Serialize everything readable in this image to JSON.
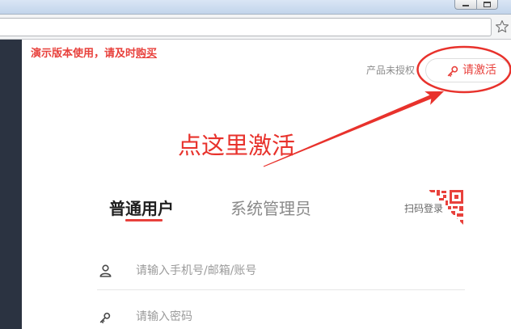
{
  "browser": {
    "icons": {
      "minimize": "minimize-icon",
      "maximize": "maximize-icon",
      "bookmark": "star-icon"
    }
  },
  "notice": {
    "prefix": "演示版本使用，请及时",
    "link": "购买"
  },
  "license": {
    "status": "产品未授权",
    "activate_label": "请激活",
    "activate_icon": "key-icon"
  },
  "annotation": {
    "text": "点这里激活"
  },
  "login": {
    "tabs": [
      {
        "label": "普通用户",
        "active": true
      },
      {
        "label": "系统管理员",
        "active": false
      }
    ],
    "qr_login": {
      "label": "扫码登录",
      "icon": "qr-code-icon"
    },
    "fields": [
      {
        "icon": "user-icon",
        "placeholder": "请输入手机号/邮箱/账号"
      },
      {
        "icon": "key-icon",
        "placeholder": "请输入密码"
      }
    ]
  },
  "colors": {
    "accent": "#e8413c",
    "annotation": "#e8322c",
    "sidebar": "#2b3341",
    "tab_inactive": "#8a8a8a"
  }
}
